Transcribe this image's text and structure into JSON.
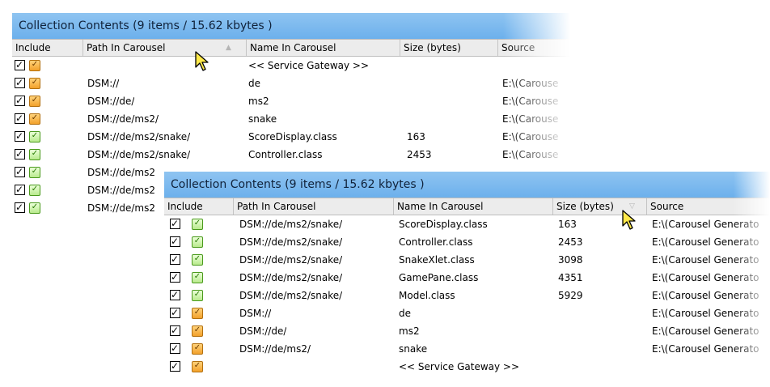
{
  "back_panel": {
    "title": "Collection Contents (9 items / 15.62 kbytes )",
    "columns": {
      "include": "Include",
      "path": "Path In Carousel",
      "name": "Name In Carousel",
      "size": "Size (bytes)",
      "source": "Source"
    },
    "sort_indicator": "▲",
    "rows": [
      {
        "path": "",
        "name": "<< Service Gateway >>",
        "size": "",
        "source": "",
        "icon": "orange"
      },
      {
        "path": "DSM://",
        "name": "de",
        "size": "",
        "source": "E:\\(Carouse",
        "icon": "orange"
      },
      {
        "path": "DSM://de/",
        "name": "ms2",
        "size": "",
        "source": "E:\\(Carouse",
        "icon": "orange"
      },
      {
        "path": "DSM://de/ms2/",
        "name": "snake",
        "size": "",
        "source": "E:\\(Carouse",
        "icon": "orange"
      },
      {
        "path": "DSM://de/ms2/snake/",
        "name": "ScoreDisplay.class",
        "size": "163",
        "source": "E:\\(Carouse",
        "icon": "green"
      },
      {
        "path": "DSM://de/ms2/snake/",
        "name": "Controller.class",
        "size": "2453",
        "source": "E:\\(Carouse",
        "icon": "green"
      },
      {
        "path": "DSM://de/ms2",
        "name": "",
        "size": "",
        "source": "",
        "icon": "green"
      },
      {
        "path": "DSM://de/ms2",
        "name": "",
        "size": "",
        "source": "",
        "icon": "green"
      },
      {
        "path": "DSM://de/ms2",
        "name": "",
        "size": "",
        "source": "",
        "icon": "green"
      }
    ]
  },
  "front_panel": {
    "title": "Collection Contents (9 items / 15.62 kbytes )",
    "columns": {
      "include": "Include",
      "path": "Path In Carousel",
      "name": "Name In Carousel",
      "size": "Size (bytes)",
      "source": "Source"
    },
    "sort_indicator": "▽",
    "rows": [
      {
        "path": "DSM://de/ms2/snake/",
        "name": "ScoreDisplay.class",
        "size": "163",
        "source": "E:\\(Carousel Generato",
        "icon": "green"
      },
      {
        "path": "DSM://de/ms2/snake/",
        "name": "Controller.class",
        "size": "2453",
        "source": "E:\\(Carousel Generato",
        "icon": "green"
      },
      {
        "path": "DSM://de/ms2/snake/",
        "name": "SnakeXlet.class",
        "size": "3098",
        "source": "E:\\(Carousel Generato",
        "icon": "green"
      },
      {
        "path": "DSM://de/ms2/snake/",
        "name": "GamePane.class",
        "size": "4351",
        "source": "E:\\(Carousel Generato",
        "icon": "green"
      },
      {
        "path": "DSM://de/ms2/snake/",
        "name": "Model.class",
        "size": "5929",
        "source": "E:\\(Carousel Generato",
        "icon": "green"
      },
      {
        "path": "DSM://",
        "name": "de",
        "size": "",
        "source": "E:\\(Carousel Generato",
        "icon": "orange"
      },
      {
        "path": "DSM://de/",
        "name": "ms2",
        "size": "",
        "source": "E:\\(Carousel Generato",
        "icon": "orange"
      },
      {
        "path": "DSM://de/ms2/",
        "name": "snake",
        "size": "",
        "source": "E:\\(Carousel Generato",
        "icon": "orange"
      },
      {
        "path": "",
        "name": "<< Service Gateway >>",
        "size": "",
        "source": "",
        "icon": "orange"
      }
    ]
  },
  "glyphs": {
    "check": "✓"
  },
  "colors": {
    "title_bar": "#7ab8ee",
    "file_orange": "#f2a12b",
    "file_green": "#b9ea8d"
  }
}
